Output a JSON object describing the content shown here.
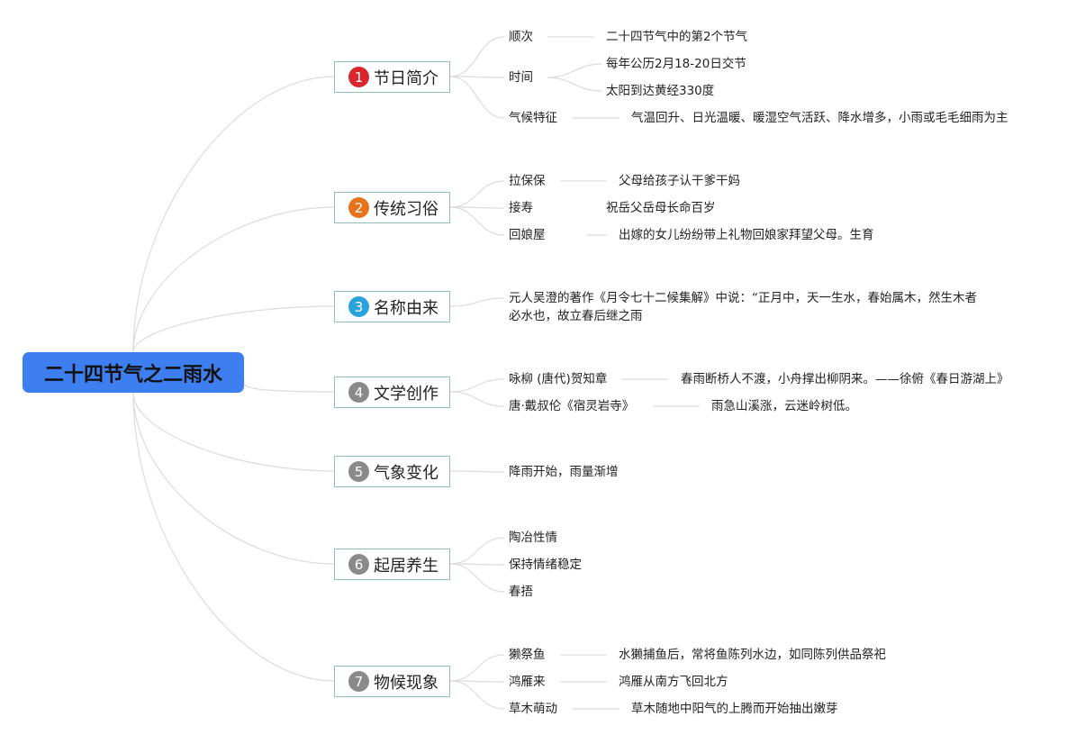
{
  "root": {
    "title": "二十四节气之二雨水"
  },
  "colors": {
    "root_fill": "#3d7ff0",
    "branch_border": "#8fbfb0",
    "link_line": "#dcdcdc",
    "badge_1": "#d9262c",
    "badge_2": "#e8711c",
    "badge_3": "#2aa3dc",
    "badge_gray": "#8a8a8a"
  },
  "branches": [
    {
      "num": "1",
      "label": "节日简介",
      "items": [
        {
          "key": "顺次",
          "values": [
            "二十四节气中的第2个节气"
          ]
        },
        {
          "key": "时间",
          "values": [
            "每年公历2月18-20日交节",
            "太阳到达黄经330度"
          ]
        },
        {
          "key": "气候特征",
          "values": [
            "气温回升、日光温暖、暖湿空气活跃、降水增多，小雨或毛毛细雨为主"
          ]
        }
      ]
    },
    {
      "num": "2",
      "label": "传统习俗",
      "items": [
        {
          "key": "拉保保",
          "values": [
            "父母给孩子认干爹干妈"
          ]
        },
        {
          "key": "接寿",
          "values": [
            "祝岳父岳母长命百岁"
          ]
        },
        {
          "key": "回娘屋",
          "values": [
            "出嫁的女儿纷纷带上礼物回娘家拜望父母。生育"
          ]
        }
      ]
    },
    {
      "num": "3",
      "label": "名称由来",
      "text": "元人吴澄的著作《月令七十二候集解》中说：“正月中，天一生水，春始属木，然生木者必水也，故立春后继之雨"
    },
    {
      "num": "4",
      "label": "文学创作",
      "items": [
        {
          "key": "咏柳 (唐代)贺知章",
          "values": [
            "春雨断桥人不渡，小舟撑出柳阴来。——徐俯《春日游湖上》"
          ]
        },
        {
          "key": "唐·戴叔伦《宿灵岩寺》",
          "values": [
            "雨急山溪涨，云迷岭树低。"
          ]
        }
      ]
    },
    {
      "num": "5",
      "label": "气象变化",
      "items": [
        {
          "key": "降雨开始，雨量渐增"
        }
      ]
    },
    {
      "num": "6",
      "label": "起居养生",
      "items": [
        {
          "key": "陶冶性情"
        },
        {
          "key": "保持情绪稳定"
        },
        {
          "key": "春捂"
        }
      ]
    },
    {
      "num": "7",
      "label": "物候现象",
      "items": [
        {
          "key": "獭祭鱼",
          "values": [
            "水獭捕鱼后，常将鱼陈列水边，如同陈列供品祭祀"
          ]
        },
        {
          "key": "鸿雁来",
          "values": [
            "鸿雁从南方飞回北方"
          ]
        },
        {
          "key": "草木萌动",
          "values": [
            "草木随地中阳气的上腾而开始抽出嫩芽"
          ]
        }
      ]
    }
  ]
}
